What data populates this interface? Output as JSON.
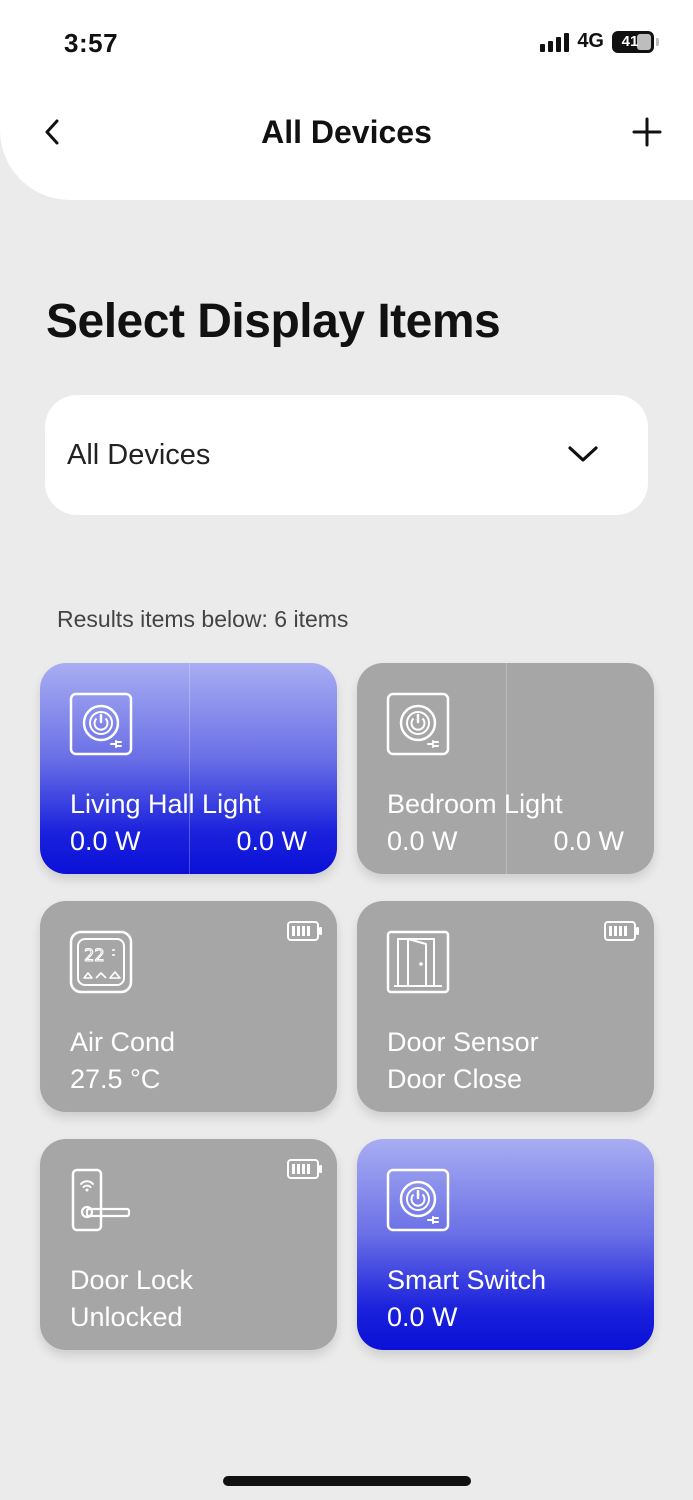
{
  "status": {
    "time": "3:57",
    "network": "4G",
    "battery": "41"
  },
  "header": {
    "title": "All Devices"
  },
  "section": {
    "title": "Select Display Items"
  },
  "filter": {
    "selected": "All Devices"
  },
  "results": {
    "text": "Results items below: 6 items"
  },
  "devices": [
    {
      "name": "Living Hall Light",
      "value": "0.0 W",
      "value2": "0.0 W",
      "icon": "power-plug-icon",
      "state": "on"
    },
    {
      "name": "Bedroom Light",
      "value": "0.0 W",
      "value2": "0.0 W",
      "icon": "power-plug-icon",
      "state": "off"
    },
    {
      "name": "Air Cond",
      "value": "27.5 °C",
      "icon": "thermostat-icon",
      "display": "22",
      "battery_icon": "battery-icon",
      "state": "off"
    },
    {
      "name": "Door Sensor",
      "value": "Door Close",
      "icon": "door-icon",
      "battery_icon": "battery-icon",
      "state": "off"
    },
    {
      "name": "Door Lock",
      "value": "Unlocked",
      "icon": "door-lock-icon",
      "battery_icon": "battery-icon",
      "state": "off"
    },
    {
      "name": "Smart Switch",
      "value": "0.0 W",
      "icon": "power-plug-icon",
      "state": "on"
    }
  ],
  "colors": {
    "active_top": "#a9adf2",
    "active_bottom": "#0a10d6",
    "inactive": "#a6a6a6",
    "background": "#ebebeb"
  }
}
